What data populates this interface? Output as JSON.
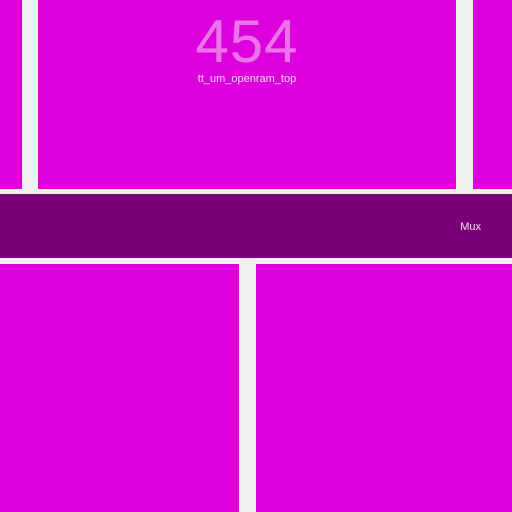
{
  "colors": {
    "background": "#f0f0f0",
    "block_magenta": "#dc00dc",
    "mux_purple": "#7a007a"
  },
  "blocks": {
    "top_main": {
      "count": "454",
      "label": "tt_um_openram_top"
    },
    "mux": {
      "label": "Mux"
    }
  }
}
